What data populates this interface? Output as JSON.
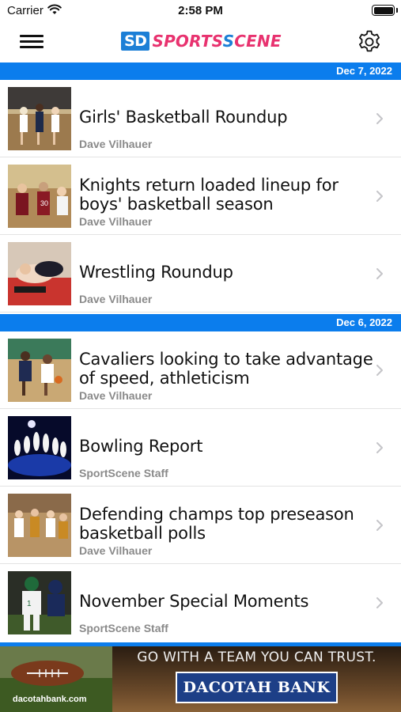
{
  "status_bar": {
    "carrier": "Carrier",
    "time": "2:58 PM"
  },
  "header": {
    "logo_sd": "SD",
    "logo_sports": "SPORTS",
    "logo_scene": "CENE",
    "logo_s2": "S"
  },
  "sections": [
    {
      "date": "Dec 7, 2022",
      "articles": [
        {
          "title": "Girls' Basketball Roundup",
          "author": "Dave Vilhauer",
          "thumb": "basketball-photo"
        },
        {
          "title": "Knights return loaded lineup for boys' basketball season",
          "author": "Dave Vilhauer",
          "thumb": "basketball-photo"
        },
        {
          "title": "Wrestling Roundup",
          "author": "Dave Vilhauer",
          "thumb": "wrestling-photo"
        }
      ]
    },
    {
      "date": "Dec 6, 2022",
      "articles": [
        {
          "title": "Cavaliers looking to take advantage of speed, athleticism",
          "author": "Dave Vilhauer",
          "thumb": "basketball-photo"
        },
        {
          "title": "Bowling Report",
          "author": "SportScene Staff",
          "thumb": "bowling-photo"
        },
        {
          "title": "Defending champs top preseason basketball polls",
          "author": "Dave Vilhauer",
          "thumb": "basketball-photo"
        },
        {
          "title": "November Special Moments",
          "author": "SportScene Staff",
          "thumb": "football-photo"
        }
      ]
    }
  ],
  "ad": {
    "tagline": "GO WITH A TEAM YOU CAN TRUST.",
    "bank": "DACOTAH BANK",
    "url": "dacotahbank.com"
  },
  "colors": {
    "accent": "#0b7ded",
    "logo_pink": "#e8326f",
    "logo_blue": "#1c7fd6",
    "author_gray": "#8a8a8a"
  },
  "icons": {
    "menu": "hamburger-menu-icon",
    "settings": "gear-icon",
    "row": "chevron-right-icon",
    "wifi": "wifi-icon",
    "battery": "battery-icon"
  }
}
